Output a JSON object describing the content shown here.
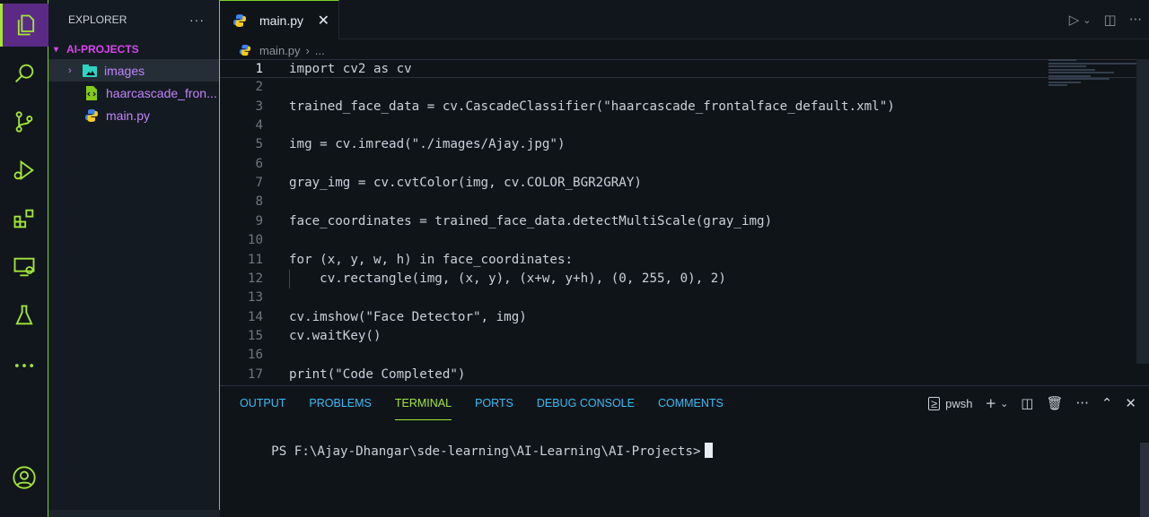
{
  "explorer": {
    "title": "EXPLORER",
    "more": "···",
    "project": "AI-PROJECTS",
    "items": [
      {
        "label": "images"
      },
      {
        "label": "haarcascade_fron..."
      },
      {
        "label": "main.py"
      }
    ]
  },
  "tab": {
    "label": "main.py",
    "close": "✕"
  },
  "breadcrumb": {
    "file": "main.py",
    "sep": "›",
    "rest": "..."
  },
  "editor": {
    "lines": [
      {
        "n": "1",
        "text": "import cv2 as cv"
      },
      {
        "n": "2",
        "text": ""
      },
      {
        "n": "3",
        "text": "trained_face_data = cv.CascadeClassifier(\"haarcascade_frontalface_default.xml\")"
      },
      {
        "n": "4",
        "text": ""
      },
      {
        "n": "5",
        "text": "img = cv.imread(\"./images/Ajay.jpg\")"
      },
      {
        "n": "6",
        "text": ""
      },
      {
        "n": "7",
        "text": "gray_img = cv.cvtColor(img, cv.COLOR_BGR2GRAY)"
      },
      {
        "n": "8",
        "text": ""
      },
      {
        "n": "9",
        "text": "face_coordinates = trained_face_data.detectMultiScale(gray_img)"
      },
      {
        "n": "10",
        "text": ""
      },
      {
        "n": "11",
        "text": "for (x, y, w, h) in face_coordinates:"
      },
      {
        "n": "12",
        "text": "    cv.rectangle(img, (x, y), (x+w, y+h), (0, 255, 0), 2)"
      },
      {
        "n": "13",
        "text": ""
      },
      {
        "n": "14",
        "text": "cv.imshow(\"Face Detector\", img)"
      },
      {
        "n": "15",
        "text": "cv.waitKey()"
      },
      {
        "n": "16",
        "text": ""
      },
      {
        "n": "17",
        "text": "print(\"Code Completed\")"
      }
    ]
  },
  "panel": {
    "tabs": [
      "OUTPUT",
      "PROBLEMS",
      "TERMINAL",
      "PORTS",
      "DEBUG CONSOLE",
      "COMMENTS"
    ],
    "shell": "pwsh",
    "prompt": "PS F:\\Ajay-Dhangar\\sde-learning\\AI-Learning\\AI-Projects>"
  },
  "colors": {
    "accent": "#a3e635",
    "folder": "#c084fc",
    "activeActivity": "#5b2a86"
  }
}
